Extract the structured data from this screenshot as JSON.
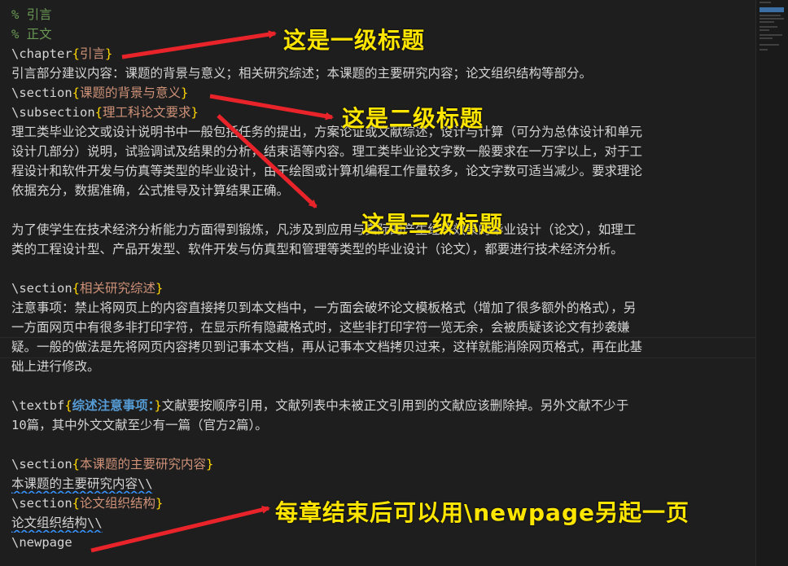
{
  "editor": {
    "lines": [
      {
        "comment": "% 引言"
      },
      {
        "comment": "% 正文"
      },
      {
        "cmd": "\\chapter",
        "arg": "引言"
      },
      {
        "text": "引言部分建议内容：课题的背景与意义；相关研究综述；本课题的主要研究内容；论文组织结构等部分。"
      },
      {
        "cmd": "\\section",
        "arg": "课题的背景与意义"
      },
      {
        "cmd": "\\subsection",
        "arg": "理工科论文要求"
      },
      {
        "text": "理工类毕业论文或设计说明书中一般包括任务的提出，方案论证或文献综述，设计与计算（可分为总体设计和单元"
      },
      {
        "text": "设计几部分）说明，试验调试及结果的分析，结束语等内容。理工类毕业论文字数一般要求在一万字以上，对于工"
      },
      {
        "text": "程设计和软件开发与仿真等类型的毕业设计，由于绘图或计算机编程工作量较多，论文字数可适当减少。要求理论"
      },
      {
        "text": "依据充分，数据准确，公式推导及计算结果正确。"
      },
      {
        "text": ""
      },
      {
        "text": "为了使学生在技术经济分析能力方面得到锻炼，凡涉及到应用与实际的产生经济效果的毕业设计（论文），如理工"
      },
      {
        "text": "类的工程设计型、产品开发型、软件开发与仿真型和管理等类型的毕业设计（论文），都要进行技术经济分析。"
      },
      {
        "text": ""
      },
      {
        "cmd": "\\section",
        "arg": "相关研究综述"
      },
      {
        "text": "注意事项：禁止将网页上的内容直接拷贝到本文档中，一方面会破坏论文模板格式（增加了很多额外的格式），另"
      },
      {
        "text": "一方面网页中有很多非打印字符，在显示所有隐藏格式时，这些非打印字符一览无余，会被质疑该论文有抄袭嫌"
      },
      {
        "text": "疑。一般的做法是先将网页内容拷贝到记事本文档，再从记事本文档拷贝过来，这样就能消除网页格式，再在此基"
      },
      {
        "text": "础上进行修改。"
      },
      {
        "text": ""
      },
      {
        "cmd": "\\textbf",
        "bold": "综述注意事项：",
        "rest": "文献要按顺序引用，文献列表中未被正文引用到的文献应该删除掉。另外文献不少于"
      },
      {
        "text": "10篇，其中外文文献至少有一篇（官方2篇）。"
      },
      {
        "text": ""
      },
      {
        "cmd": "\\section",
        "arg": "本课题的主要研究内容"
      },
      {
        "text": "本课题的主要研究内容\\\\"
      },
      {
        "cmd": "\\section",
        "arg": "论文组织结构"
      },
      {
        "text": "论文组织结构\\\\"
      },
      {
        "text": "\\newpage"
      }
    ]
  },
  "annotations": {
    "level1": "这是一级标题",
    "level2": "这是二级标题",
    "level3": "这是三级标题",
    "newpage": "每章结束后可以用\\newpage另起一页"
  },
  "colors": {
    "background": "#1e1e1e",
    "text": "#d4d4d4",
    "comment": "#6a9955",
    "brace": "#ffd700",
    "argument": "#ce9178",
    "bold_arg": "#569cd6",
    "annotation": "#ffe600",
    "arrow": "#e8232a"
  }
}
